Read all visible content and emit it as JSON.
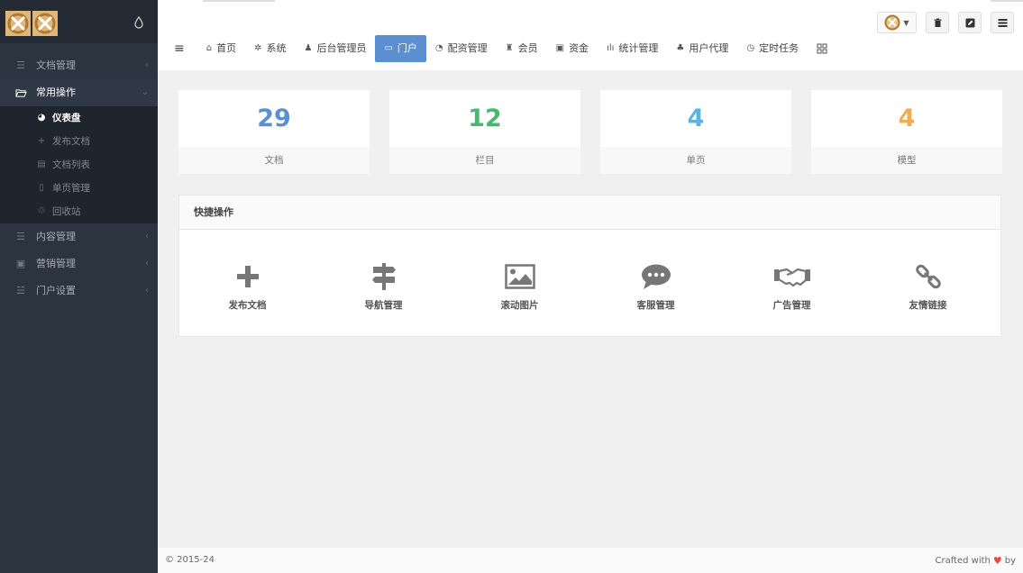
{
  "sidebar": {
    "items": [
      {
        "label": "文档管理",
        "icon": "list-icon"
      },
      {
        "label": "常用操作",
        "icon": "folder-open-icon",
        "active": true
      },
      {
        "label": "内容管理",
        "icon": "list-icon"
      },
      {
        "label": "营销管理",
        "icon": "money-icon"
      },
      {
        "label": "门户设置",
        "icon": "sliders-icon"
      }
    ],
    "submenu": [
      {
        "label": "仪表盘",
        "icon": "dashboard-icon",
        "active": true
      },
      {
        "label": "发布文档",
        "icon": "plus-icon"
      },
      {
        "label": "文档列表",
        "icon": "list-icon"
      },
      {
        "label": "单页管理",
        "icon": "file-icon"
      },
      {
        "label": "回收站",
        "icon": "recycle-icon"
      }
    ]
  },
  "header": {
    "menu": [
      {
        "label": "首页",
        "icon": "home-icon"
      },
      {
        "label": "系统",
        "icon": "gear-icon"
      },
      {
        "label": "后台管理员",
        "icon": "user-icon"
      },
      {
        "label": "门户",
        "icon": "portal-icon",
        "active": true
      },
      {
        "label": "配资管理",
        "icon": "pie-icon"
      },
      {
        "label": "会员",
        "icon": "users-icon"
      },
      {
        "label": "资金",
        "icon": "money-icon"
      },
      {
        "label": "统计管理",
        "icon": "bar-chart-icon"
      },
      {
        "label": "用户代理",
        "icon": "sitemap-icon"
      },
      {
        "label": "定时任务",
        "icon": "clock-icon"
      }
    ]
  },
  "stats": [
    {
      "value": "29",
      "label": "文档",
      "color": "#5b8fd1"
    },
    {
      "value": "12",
      "label": "栏目",
      "color": "#46b96f"
    },
    {
      "value": "4",
      "label": "单页",
      "color": "#5bb3e0"
    },
    {
      "value": "4",
      "label": "模型",
      "color": "#f0ad4e"
    }
  ],
  "quick": {
    "title": "快捷操作",
    "items": [
      {
        "label": "发布文档",
        "icon": "plus-icon"
      },
      {
        "label": "导航管理",
        "icon": "signpost-icon"
      },
      {
        "label": "滚动图片",
        "icon": "image-icon"
      },
      {
        "label": "客服管理",
        "icon": "chat-icon"
      },
      {
        "label": "广告管理",
        "icon": "handshake-icon"
      },
      {
        "label": "友情链接",
        "icon": "link-icon"
      }
    ]
  },
  "footer": {
    "left": "© 2015-24",
    "right_text": "Crafted with",
    "right_suffix": "by"
  },
  "colors": {
    "sidebar_bg": "#2c343f",
    "accent": "#5b8fd1"
  }
}
